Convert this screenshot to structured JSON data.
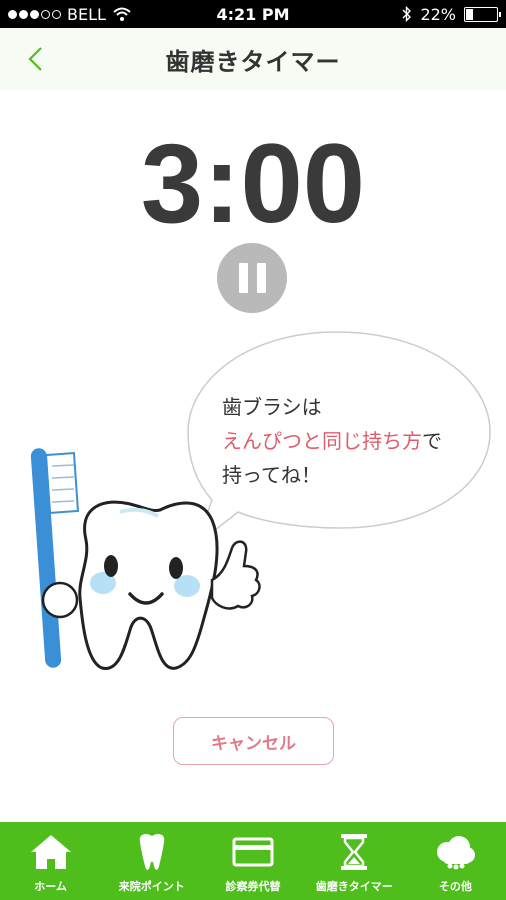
{
  "status_bar": {
    "carrier": "BELL",
    "time": "4:21 PM",
    "battery": "22%",
    "battery_level": 0.22,
    "signal_bars": 3,
    "icons": [
      "wifi-icon",
      "bluetooth-icon",
      "battery-icon"
    ]
  },
  "nav": {
    "back_label": "<",
    "title": "歯磨きタイマー"
  },
  "timer": {
    "display": "3:00"
  },
  "bubble": {
    "line1": "歯ブラシは",
    "line2_highlight": "えんぴつと同じ持ち方",
    "line2_tail": "で",
    "line3": "持ってね！"
  },
  "cancel_label": "キャンセル",
  "tabs": [
    {
      "label": "ホーム",
      "icon": "home-icon"
    },
    {
      "label": "来院ポイント",
      "icon": "tooth-icon"
    },
    {
      "label": "診察券代替",
      "icon": "card-icon"
    },
    {
      "label": "歯磨きタイマー",
      "icon": "hourglass-icon"
    },
    {
      "label": "その他",
      "icon": "cloud-icon"
    }
  ],
  "colors": {
    "accent_green": "#4fbe1d",
    "highlight_pink": "#e15b6c",
    "cancel_border": "#e8a3ad",
    "timer_text": "#3a3a3a"
  }
}
